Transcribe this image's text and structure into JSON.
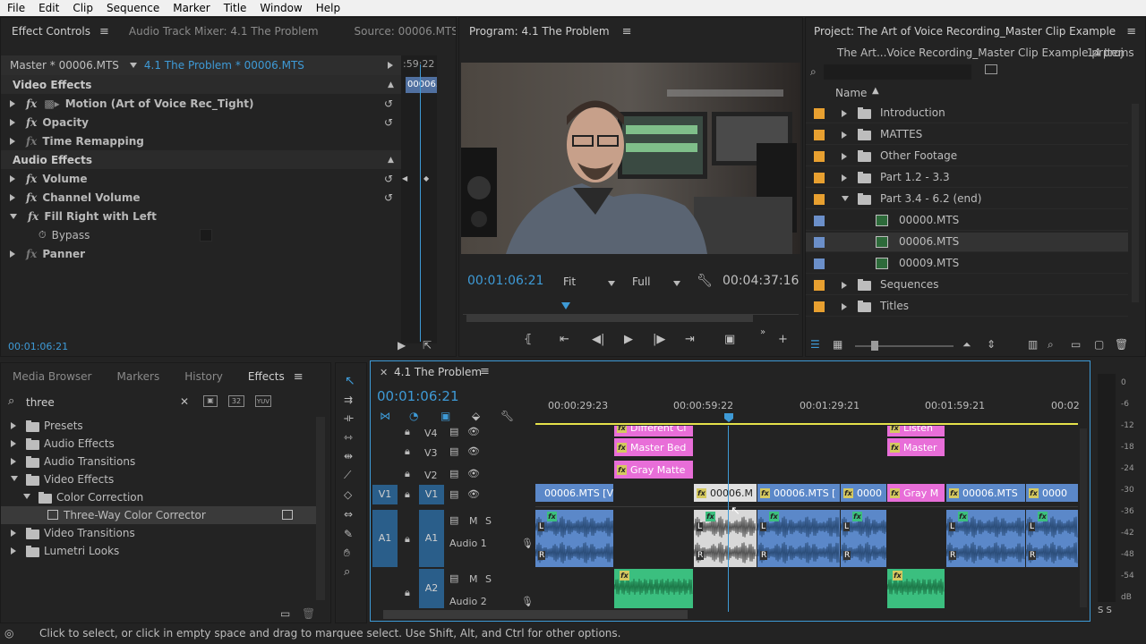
{
  "menu": [
    "File",
    "Edit",
    "Clip",
    "Sequence",
    "Marker",
    "Title",
    "Window",
    "Help"
  ],
  "effect_controls": {
    "tabs": [
      "Effect Controls",
      "Audio Track Mixer: 4.1 The Problem",
      "Source: 00006.MTS"
    ],
    "master_label": "Master * 00006.MTS",
    "sequence_clip": "4.1 The Problem * 00006.MTS",
    "mini_time": ":59:22",
    "mini_clip": "00006.",
    "video_effects": "Video Effects",
    "motion": "Motion (Art of Voice Rec_Tight)",
    "opacity": "Opacity",
    "time_remapping": "Time Remapping",
    "audio_effects": "Audio Effects",
    "volume": "Volume",
    "channel_volume": "Channel Volume",
    "fill_right": "Fill Right with Left",
    "bypass": "Bypass",
    "panner": "Panner",
    "timecode": "00:01:06:21"
  },
  "program": {
    "title": "Program: 4.1 The Problem",
    "timecode": "00:01:06:21",
    "fit": "Fit",
    "quality": "Full",
    "duration": "00:04:37:16"
  },
  "project": {
    "title": "Project: The Art of Voice Recording_Master Clip Example",
    "file": "The Art...Voice Recording_Master Clip Example.prproj",
    "items": "14 Items",
    "name_col": "Name",
    "rows": [
      {
        "label": "Introduction",
        "type": "folder",
        "color": "#e8a030"
      },
      {
        "label": "MATTES",
        "type": "folder",
        "color": "#e8a030"
      },
      {
        "label": "Other Footage",
        "type": "folder",
        "color": "#e8a030"
      },
      {
        "label": "Part 1.2 - 3.3",
        "type": "folder",
        "color": "#e8a030"
      },
      {
        "label": "Part 3.4 - 6.2 (end)",
        "type": "folder-open",
        "color": "#e8a030"
      },
      {
        "label": "00000.MTS",
        "type": "clip",
        "color": "#6b8fc9"
      },
      {
        "label": "00006.MTS",
        "type": "clip",
        "color": "#6b8fc9"
      },
      {
        "label": "00009.MTS",
        "type": "clip",
        "color": "#6b8fc9"
      },
      {
        "label": "Sequences",
        "type": "folder",
        "color": "#e8a030"
      },
      {
        "label": "Titles",
        "type": "folder",
        "color": "#e8a030"
      }
    ]
  },
  "effects_panel": {
    "tabs": [
      "Media Browser",
      "Markers",
      "History",
      "Effects"
    ],
    "search": "three",
    "badges": [
      "32",
      "YUV"
    ],
    "tree": [
      {
        "label": "Presets",
        "level": 0,
        "open": false
      },
      {
        "label": "Audio Effects",
        "level": 0,
        "open": false
      },
      {
        "label": "Audio Transitions",
        "level": 0,
        "open": false
      },
      {
        "label": "Video Effects",
        "level": 0,
        "open": true
      },
      {
        "label": "Color Correction",
        "level": 1,
        "open": true
      },
      {
        "label": "Three-Way Color Corrector",
        "level": 2,
        "open": false
      },
      {
        "label": "Video Transitions",
        "level": 0,
        "open": false
      },
      {
        "label": "Lumetri Looks",
        "level": 0,
        "open": false
      }
    ]
  },
  "timeline": {
    "tab": "4.1 The Problem",
    "timecode": "00:01:06:21",
    "ruler": [
      "00:00:29:23",
      "00:00:59:22",
      "00:01:29:21",
      "00:01:59:21",
      "00:02"
    ],
    "tracks": {
      "v4": "V4",
      "v3": "V3",
      "v2": "V2",
      "v1": "V1",
      "a1": "A1",
      "a2": "A2",
      "audio1": "Audio 1",
      "audio2": "Audio 2",
      "m": "M",
      "s": "S"
    },
    "clips": {
      "v4a": "Different Ci",
      "v4b": "Listen",
      "v3a": "Master Bed",
      "v3b": "Master",
      "v2a": "Gray Matte",
      "v1a": "00006.MTS [V]",
      "v1b": "00006.M",
      "v1c": "00006.MTS [",
      "v1d": "0000",
      "v1e": "Gray M",
      "v1f": "00006.MTS",
      "v1g": "0000"
    },
    "lr": {
      "l": "L",
      "r": "R"
    }
  },
  "meter": {
    "labels": [
      "0",
      "-6",
      "-12",
      "-18",
      "-24",
      "-30",
      "-36",
      "-42",
      "-48",
      "-54",
      "dB"
    ],
    "solo": "S S"
  },
  "status": "Click to select, or click in empty space and drag to marquee select. Use Shift, Alt, and Ctrl for other options.",
  "colors": {
    "accent": "#3e9ad6",
    "pink": "#e86ed8",
    "v1clip": "#5b88c9",
    "audio": "#5b88c9",
    "green": "#3bbf7f"
  }
}
